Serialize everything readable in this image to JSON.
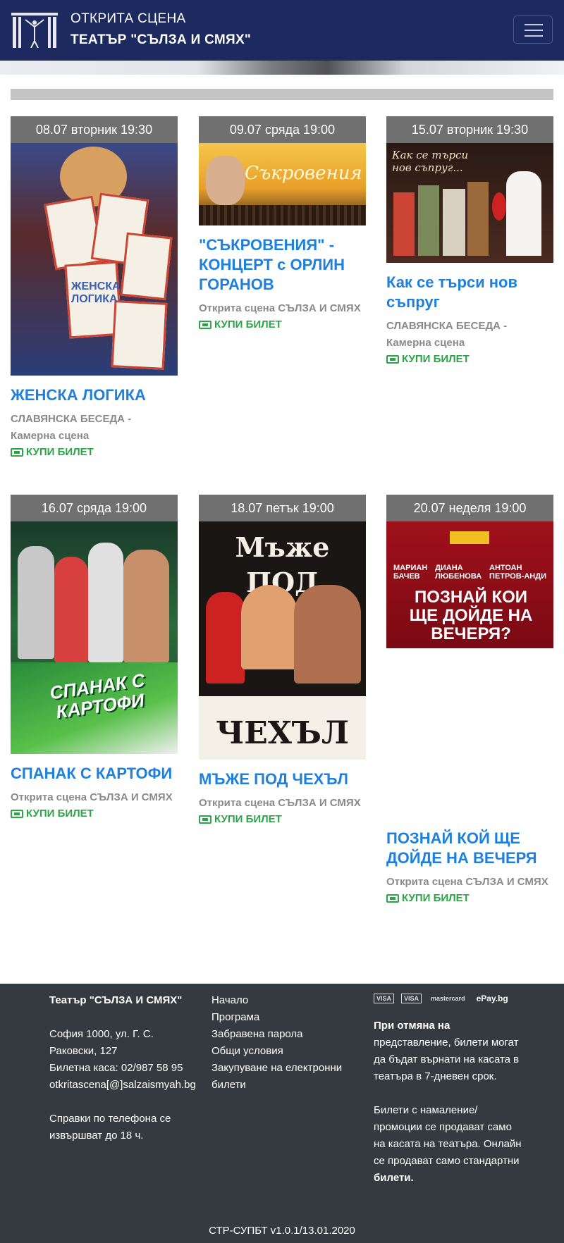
{
  "header": {
    "brand_line1": "ОТКРИТА СЦЕНА",
    "brand_line2": "ТЕАТЪР \"СЪЛЗА И СМЯХ\""
  },
  "events": [
    {
      "date": "08.07 вторник 19:30",
      "title": "ЖЕНСКА ЛОГИКА",
      "venue": "СЛАВЯНСКА БЕСЕДА - Камерна сцена",
      "buy": "КУПИ БИЛЕТ",
      "poster_text": "ЖЕНСКА ЛОГИКА"
    },
    {
      "date": "09.07 сряда 19:00",
      "title": "\"СЪКРОВЕНИЯ\" - КОНЦЕРТ с ОРЛИН ГОРАНОВ",
      "venue": "Открита сцена СЪЛЗА И СМЯХ",
      "buy": "КУПИ БИЛЕТ",
      "poster_text": "Съкровения"
    },
    {
      "date": "15.07 вторник 19:30",
      "title": "Как се търси нов съпруг",
      "venue": "СЛАВЯНСКА БЕСЕДА - Камерна сцена",
      "buy": "КУПИ БИЛЕТ",
      "poster_text": "Как се търси нов съпруг..."
    },
    {
      "date": "16.07 сряда 19:00",
      "title": "СПАНАК С КАРТОФИ",
      "venue": "Открита сцена СЪЛЗА И СМЯХ",
      "buy": "КУПИ БИЛЕТ",
      "poster_text": "СПАНАК С КАРТОФИ"
    },
    {
      "date": "18.07 петък 19:00",
      "title": "МЪЖЕ ПОД ЧЕХЪЛ",
      "venue": "Открита сцена СЪЛЗА И СМЯХ",
      "buy": "КУПИ БИЛЕТ",
      "poster_text": "Мъже ПОД ЧЕХЪЛ"
    },
    {
      "date": "20.07 неделя 19:00",
      "title": "ПОЗНАЙ КОЙ ЩЕ ДОЙДЕ НА ВЕЧЕРЯ",
      "venue": "Открита сцена СЪЛЗА И СМЯХ",
      "buy": "КУПИ БИЛЕТ",
      "poster_text": "ПОЗНАЙ КОИ ЩЕ ДОЙДЕ НА ВЕЧЕРЯ?"
    }
  ],
  "footer": {
    "theatre_name": "Театър \"СЪЛЗА И СМЯХ\"",
    "address_1": "София 1000, ул. Г. С.",
    "address_2": "Раковски, 127",
    "box_office": "Билетна каса: 02/987 58 95",
    "email": "otkritascena[@]salzaismyah.bg",
    "phone_note_1": "Справки по телефона се",
    "phone_note_2": "извършват до 18 ч.",
    "links": [
      "Начало",
      "Програма",
      "Забравена парола",
      "Общи условия",
      "Закупуване на електронни",
      "билети"
    ],
    "refund_note": [
      "При отмяна на",
      "представление, билети могат",
      "да бъдат върнати на касата в",
      "театъра в 7-дневен срок."
    ],
    "discount_note": [
      "Билети с намаление/",
      "промоции се продават само",
      "на касата на театъра. Онлайн",
      "се продават само стандартни",
      "билети."
    ],
    "payment_logos": [
      "VISA",
      "VISA",
      "mastercard",
      "ePay.bg"
    ],
    "version": "СТР-СУПБТ v1.0.1/13.01.2020"
  }
}
